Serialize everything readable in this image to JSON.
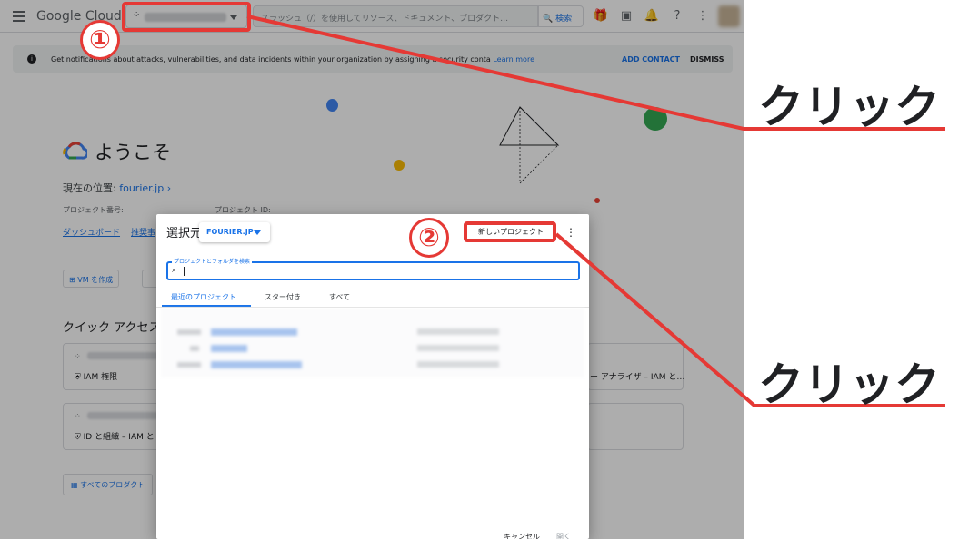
{
  "console": {
    "logo_google": "Google",
    "logo_cloud": "Cloud",
    "search_placeholder": "スラッシュ（/）を使用してリソース、ドキュメント、プロダクト…",
    "search_button": "検索",
    "banner_message": "Get notifications about attacks, vulnerabilities, and data incidents within your organization by assigning a security conta",
    "banner_link": "Learn more",
    "banner_add_contact": "ADD CONTACT",
    "banner_dismiss": "DISMISS",
    "welcome": "ようこそ",
    "location_label": "現在の位置:",
    "location_org": "fourier.jp",
    "project_number_label": "プロジェクト番号:",
    "project_id_label": "プロジェクト ID:",
    "dashboard_link": "ダッシュボード",
    "recommend_link": "推奨事",
    "create_vm_button": "VM を作成",
    "quick_access_title": "クイック アクセス",
    "card1_line2": "IAM 権限",
    "card2_line2": "ID と組織 – IAM と",
    "card_right_text": "ー アナライザ – IAM と…",
    "all_products_button": "すべてのプロダクト"
  },
  "dialog": {
    "title": "選択元",
    "org_selector": "FOURIER.JP",
    "new_project_button": "新しいプロジェクト",
    "search_label": "プロジェクトとフォルダを検索",
    "tabs": [
      "最近のプロジェクト",
      "スター付き",
      "すべて"
    ],
    "footer_cancel": "キャンセル",
    "footer_open": "開く"
  },
  "annotations": {
    "step1": "①",
    "step2": "②",
    "click_label_1": "クリック",
    "click_label_2": "クリック"
  },
  "colors": {
    "annotation_red": "#e53935",
    "google_blue": "#1a73e8"
  }
}
